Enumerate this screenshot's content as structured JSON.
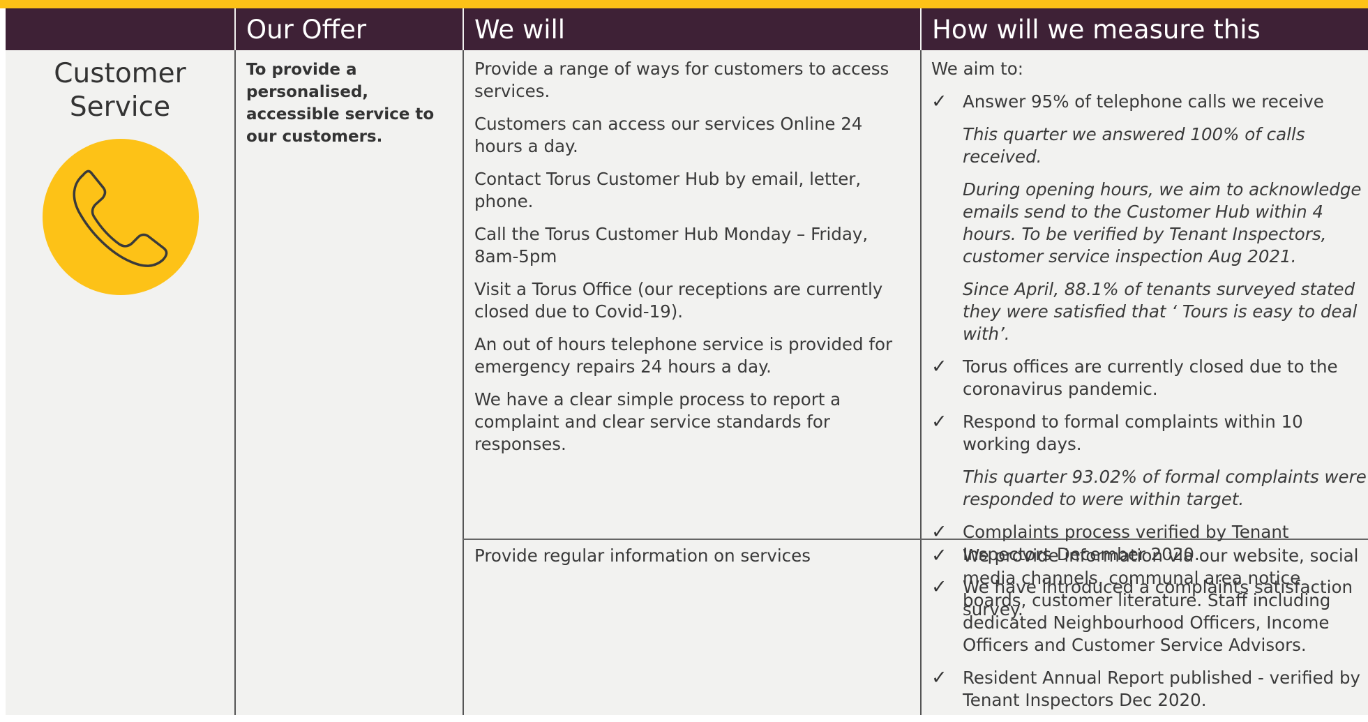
{
  "header": {
    "col1": "",
    "col2": "Our Offer",
    "col3": "We will",
    "col4": "How will we measure this"
  },
  "category": {
    "title": "Customer Service",
    "icon": "phone-icon",
    "icon_bg": "#fdc217"
  },
  "offer": {
    "text": "To provide a personalised, accessible service to our customers."
  },
  "section1": {
    "will": [
      "Provide a range of ways for customers to access services.",
      "Customers can access our services Online 24 hours a day.",
      "Contact Torus Customer Hub by email, letter, phone.",
      "Call the Torus Customer Hub Monday – Friday, 8am-5pm",
      "Visit a Torus Office (our receptions are currently closed due to Covid-19).",
      "An out of hours telephone service is provided for emergency repairs 24 hours a day.",
      "We have a clear simple process to report a complaint and clear service standards for responses."
    ],
    "measure": {
      "intro": "We aim to:",
      "tick": "✓",
      "item1": "Answer 95% of telephone calls we receive",
      "note1": "This quarter we answered 100% of calls received.",
      "note2": "During opening hours, we aim to acknowledge emails send to the Customer Hub within 4 hours. To be verified by Tenant Inspectors, customer service inspection Aug 2021.",
      "note3": "Since April,  88.1% of tenants surveyed stated they were satisfied that ‘ Tours is easy to deal with’.",
      "item2": "Torus offices are currently closed due to the coronavirus pandemic.",
      "item3": "Respond to formal complaints within 10 working days.",
      "note4": "This quarter 93.02% of formal complaints were responded to were within target.",
      "item4": "Complaints process verified by Tenant Inspectors December 2020.",
      "item5": "We have introduced a complaints satisfaction survey."
    }
  },
  "section2": {
    "will": "Provide regular information on services",
    "measure": {
      "item1": "We provide information via our website, social media channels, communal area notice boards, customer literature. Staff including dedicated Neighbourhood Officers, Income Officers and Customer Service Advisors.",
      "item2": "Resident Annual Report published - verified by Tenant Inspectors Dec 2020."
    }
  }
}
